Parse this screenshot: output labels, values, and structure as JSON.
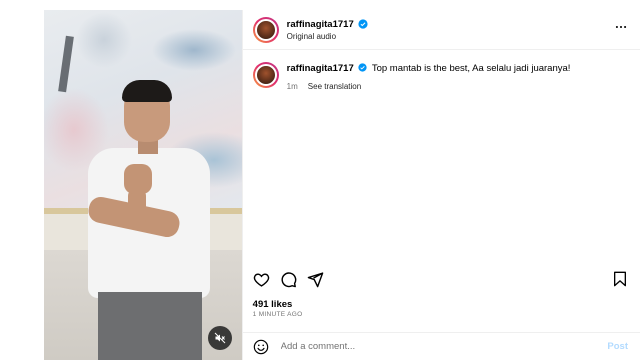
{
  "post": {
    "username": "raffinagita1717",
    "audio": "Original audio",
    "verified": true
  },
  "icons": {
    "verified": "verified-badge-icon",
    "more": "more-options-icon",
    "like": "heart-icon",
    "comment": "comment-bubble-icon",
    "share": "paper-plane-icon",
    "save": "bookmark-icon",
    "emoji": "emoji-smiley-icon",
    "mute": "speaker-muted-icon"
  },
  "caption": {
    "username": "raffinagita1717",
    "text": "Top mantab is the best, Aa selalu jadi juaranya!",
    "time": "1m",
    "see_translation": "See translation"
  },
  "engagement": {
    "likes": "491 likes",
    "time_ago": "1 MINUTE AGO"
  },
  "comment_box": {
    "placeholder": "Add a comment...",
    "post_label": "Post"
  },
  "colors": {
    "verified_blue": "#0095f6",
    "post_disabled": "#b3dbff"
  }
}
